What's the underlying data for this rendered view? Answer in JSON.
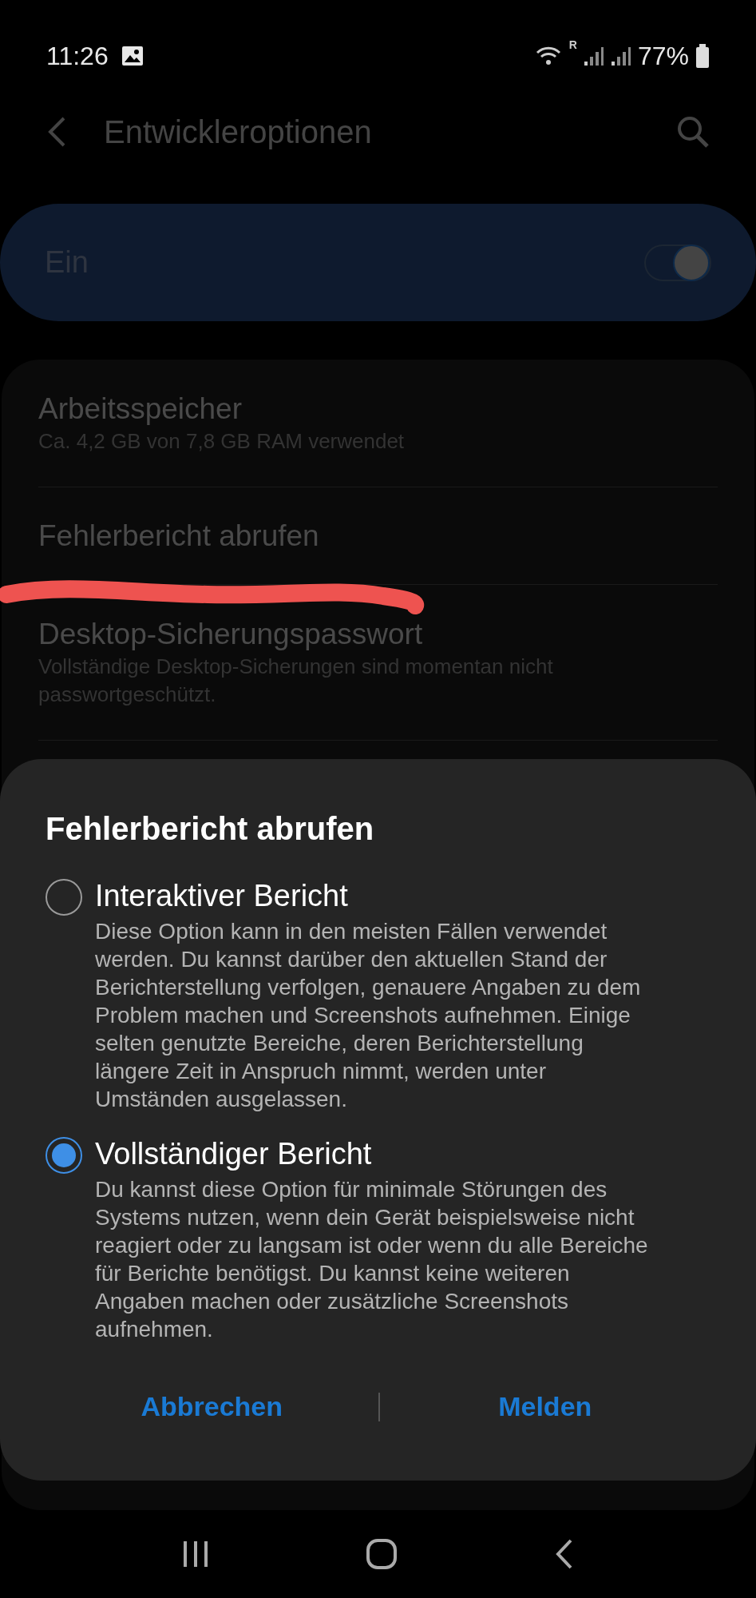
{
  "status_bar": {
    "time": "11:26",
    "battery": "77%",
    "roaming": "R"
  },
  "header": {
    "title": "Entwickleroptionen"
  },
  "master_switch": {
    "label": "Ein",
    "on": true
  },
  "settings": [
    {
      "title": "Arbeitsspeicher",
      "subtitle": "Ca. 4,2 GB von 7,8 GB RAM verwendet"
    },
    {
      "title": "Fehlerbericht abrufen"
    },
    {
      "title": "Desktop-Sicherungspasswort",
      "subtitle": "Vollständige Desktop-Sicherungen sind momentan nicht passwortgeschützt."
    }
  ],
  "dialog": {
    "title": "Fehlerbericht abrufen",
    "options": [
      {
        "label": "Interaktiver Bericht",
        "description": "Diese Option kann in den meisten Fällen verwendet werden. Du kannst darüber den aktuellen Stand der Berichterstellung verfolgen, genauere Angaben zu dem Problem machen und Screenshots aufnehmen. Einige selten genutzte Bereiche, deren Berichterstellung längere Zeit in Anspruch nimmt, werden unter Umständen ausgelassen.",
        "selected": false
      },
      {
        "label": "Vollständiger Bericht",
        "description": "Du kannst diese Option für minimale Störungen des Systems nutzen, wenn dein Gerät beispielsweise nicht reagiert oder zu langsam ist oder wenn du alle Bereiche für Berichte benötigst. Du kannst keine weiteren Angaben machen oder zusätzliche Screenshots aufnehmen.",
        "selected": true
      }
    ],
    "buttons": [
      "Abbrechen",
      "Melden"
    ]
  }
}
